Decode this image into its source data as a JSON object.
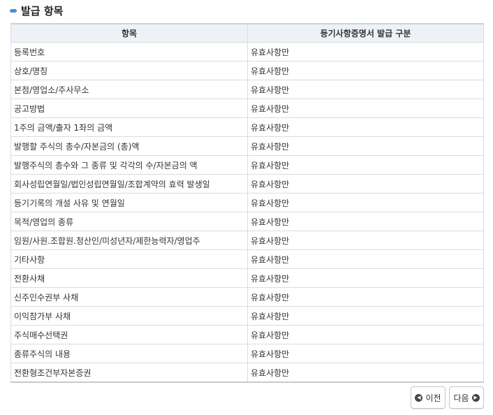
{
  "section": {
    "title": "발급 항목",
    "accent_color": "#4a90d9"
  },
  "table": {
    "headers": [
      "항목",
      "등기사항증명서 발급 구분"
    ],
    "rows": [
      [
        "등록번호",
        "유효사항만"
      ],
      [
        "상호/명칭",
        "유효사항만"
      ],
      [
        "본점/영업소/주사무소",
        "유효사항만"
      ],
      [
        "공고방법",
        "유효사항만"
      ],
      [
        "1주의 금액/출자 1좌의 금액",
        "유효사항만"
      ],
      [
        "발행할 주식의 총수/자본금의 (총)액",
        "유효사항만"
      ],
      [
        "발행주식의 총수와 그 종류 및 각각의 수/자본금의 액",
        "유효사항만"
      ],
      [
        "회사성립연월일/법인성립연월일/조합계약의 효력 발생일",
        "유효사항만"
      ],
      [
        "등기기록의 개설 사유 및 연월일",
        "유효사항만"
      ],
      [
        "목적/영업의 종류",
        "유효사항만"
      ],
      [
        "임원/사원.조합원.청산인/미성년자/제한능력자/영업주",
        "유효사항만"
      ],
      [
        "기타사항",
        "유효사항만"
      ],
      [
        "전환사채",
        "유효사항만"
      ],
      [
        "신주인수권부 사채",
        "유효사항만"
      ],
      [
        "이익참가부 사채",
        "유효사항만"
      ],
      [
        "주식매수선택권",
        "유효사항만"
      ],
      [
        "종류주식의 내용",
        "유효사항만"
      ],
      [
        "전환형조건부자본증권",
        "유효사항만"
      ]
    ]
  },
  "pagination": {
    "prev_label": "이전",
    "next_label": "다음",
    "prev_icon": "chevron-left-circle-icon",
    "next_icon": "chevron-right-circle-icon"
  }
}
